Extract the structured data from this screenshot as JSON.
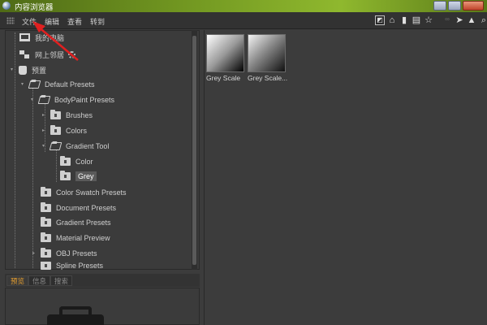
{
  "window": {
    "title": "内容浏览器"
  },
  "menu": {
    "items": [
      "文件",
      "编辑",
      "查看",
      "转到"
    ]
  },
  "toolbar": {
    "tools": [
      {
        "icon": "view-icon",
        "glyph": "◩"
      },
      {
        "icon": "home-icon",
        "glyph": "⌂"
      },
      {
        "icon": "bin-icon",
        "glyph": "▮"
      },
      {
        "icon": "book-icon",
        "glyph": "▤"
      },
      {
        "icon": "star-icon",
        "glyph": "☆"
      },
      {
        "icon": "link-icon",
        "glyph": "∞"
      },
      {
        "icon": "cursor-icon",
        "glyph": "➤"
      },
      {
        "icon": "up-icon",
        "glyph": "▲"
      },
      {
        "icon": "search-icon",
        "glyph": "⌕"
      }
    ]
  },
  "tree": {
    "items": [
      {
        "label": "我的电脑",
        "icon": "computer-icon"
      },
      {
        "label": "网上邻居",
        "icon": "network-icon"
      },
      {
        "label": "预置",
        "icon": "presets-icon"
      },
      {
        "label": "Default Presets",
        "icon": "folder-open-icon"
      },
      {
        "label": "BodyPaint Presets",
        "icon": "folder-open-icon"
      },
      {
        "label": "Brushes",
        "icon": "folder-icon"
      },
      {
        "label": "Colors",
        "icon": "folder-icon"
      },
      {
        "label": "Gradient Tool",
        "icon": "folder-open-icon"
      },
      {
        "label": "Color",
        "icon": "folder-icon"
      },
      {
        "label": "Grey",
        "icon": "folder-icon",
        "selected": true
      },
      {
        "label": "Color Swatch Presets",
        "icon": "folder-icon"
      },
      {
        "label": "Document Presets",
        "icon": "folder-icon"
      },
      {
        "label": "Gradient Presets",
        "icon": "folder-icon"
      },
      {
        "label": "Material Preview",
        "icon": "folder-icon"
      },
      {
        "label": "OBJ Presets",
        "icon": "folder-icon"
      },
      {
        "label": "Spline Presets",
        "icon": "folder-icon"
      }
    ]
  },
  "bottom_tabs": {
    "items": [
      "预览",
      "信息",
      "搜索"
    ],
    "active": 0
  },
  "content": {
    "items": [
      {
        "label": "Grey Scale"
      },
      {
        "label": "Grey Scale..."
      }
    ]
  },
  "colors": {
    "accent_tab": "#e8a030",
    "arrow": "#e02020"
  }
}
